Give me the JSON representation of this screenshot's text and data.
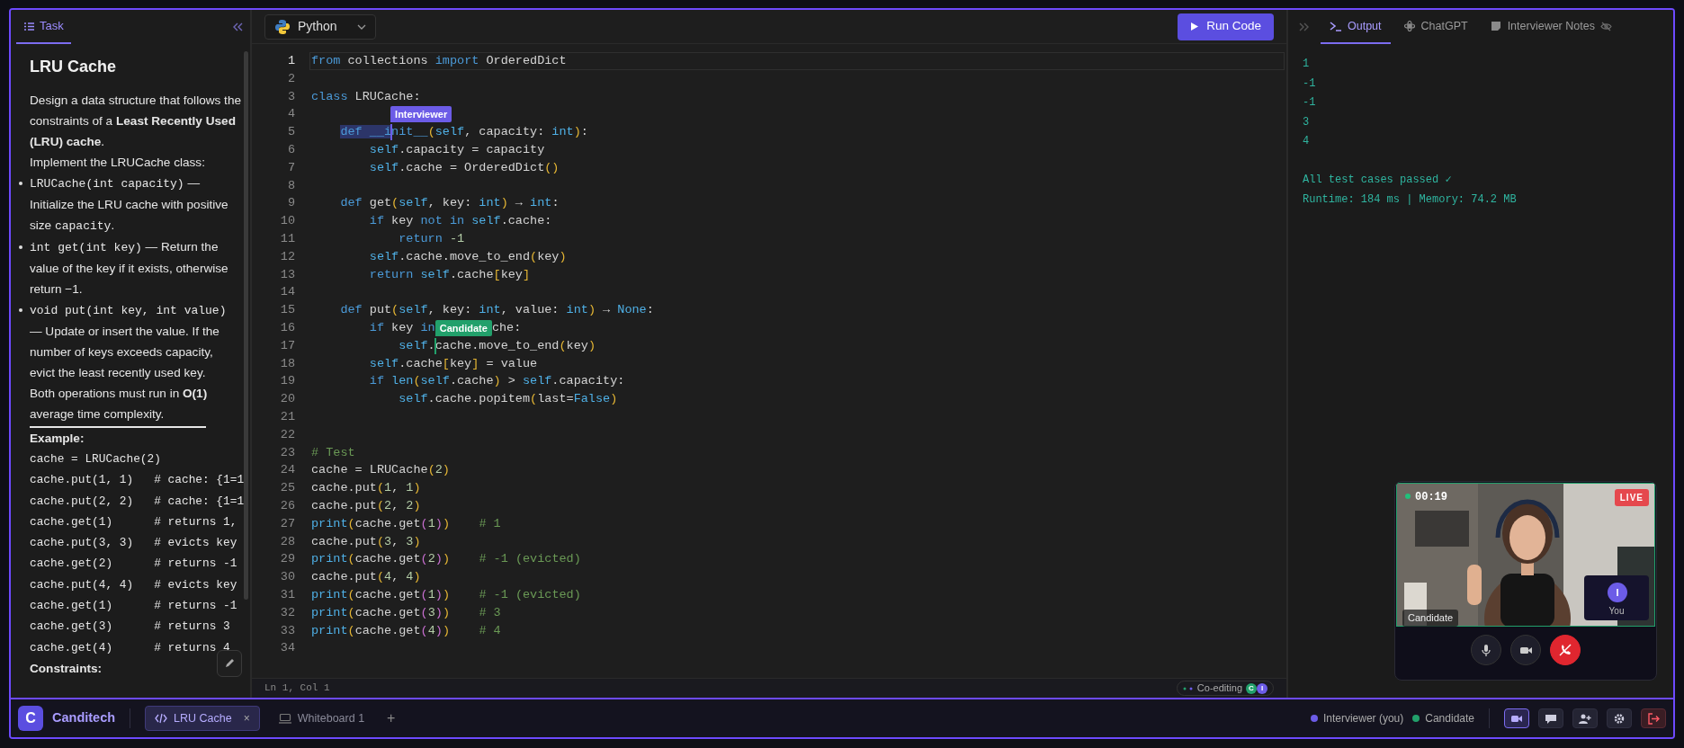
{
  "task_panel": {
    "tabs": [
      {
        "label": "Task",
        "selected": true
      }
    ],
    "title": "LRU Cache",
    "paragraphs": [
      "Design a data structure that follows the constraints of a **Least Recently Used (LRU) cache**.",
      "Implement the LRUCache class:"
    ],
    "bullets": [
      [
        {
          "kind": "code",
          "text": "LRUCache(int capacity)"
        },
        {
          "kind": "text",
          "text": " — Initialize the LRU cache with positive size "
        },
        {
          "kind": "code",
          "text": "capacity"
        },
        {
          "kind": "text",
          "text": "."
        }
      ],
      [
        {
          "kind": "code",
          "text": "int get(int key)"
        },
        {
          "kind": "text",
          "text": " — Return the value of the key if it exists, otherwise return −1."
        }
      ],
      [
        {
          "kind": "code",
          "text": "void put(int key, int value)"
        },
        {
          "kind": "text",
          "text": " — Update or insert the value. If the number of keys exceeds capacity, evict the least recently used key."
        }
      ]
    ],
    "note": "Both operations must run in **O(1)** average time complexity.",
    "example_heading": "Example:",
    "example_lines": [
      "cache = LRUCache(2)",
      "cache.put(1, 1)   # cache: {1=1",
      "cache.put(2, 2)   # cache: {1=1",
      "cache.get(1)      # returns 1,",
      "cache.put(3, 3)   # evicts key",
      "cache.get(2)      # returns -1",
      "cache.put(4, 4)   # evicts key",
      "cache.get(1)      # returns -1",
      "cache.get(3)      # returns 3",
      "cache.get(4)      # returns 4"
    ],
    "constraints_heading": "Constraints:"
  },
  "editor": {
    "language": "Python",
    "run_button": "Run Code",
    "status": "Ln 1, Col 1",
    "coediting": {
      "label": "Co-editing",
      "avatars": [
        {
          "initial": "C",
          "color": "#22a06b"
        },
        {
          "initial": "I",
          "color": "#6c5ce7"
        }
      ]
    },
    "lines": [
      {
        "number": "1",
        "current": true,
        "segments": [
          {
            "kind": "keyword",
            "text": "from"
          },
          {
            "kind": "plain",
            "text": " collections "
          },
          {
            "kind": "keyword",
            "text": "import"
          },
          {
            "kind": "plain",
            "text": " OrderedDict"
          }
        ]
      },
      {
        "number": "2",
        "current": false
      },
      {
        "number": "3",
        "current": false,
        "segments": [
          {
            "kind": "keyword",
            "text": "class"
          },
          {
            "kind": "plain",
            "text": " LRUCache:"
          }
        ],
        "children": [
          {
            "number": "4",
            "current": false,
            "segments": [
              {
                "kind": "cursor-label",
                "label": "Interviewer",
                "color": "#6c5ce7"
              }
            ]
          },
          {
            "number": "5",
            "current": false,
            "segments": [
              {
                "kind": "selection",
                "text": "def __i"
              },
              {
                "kind": "caret",
                "color": "#6c5ce7"
              },
              {
                "kind": "keyword",
                "text": "nit__"
              },
              {
                "kind": "paren",
                "text": "("
              },
              {
                "kind": "builtin",
                "text": "self"
              },
              {
                "kind": "plain",
                "text": ", capacity: "
              },
              {
                "kind": "builtin",
                "text": "int"
              },
              {
                "kind": "paren",
                "text": ")"
              },
              {
                "kind": "plain",
                "text": ":"
              }
            ],
            "children": [
              {
                "number": "6",
                "current": false,
                "segments": [
                  {
                    "kind": "builtin",
                    "text": "self"
                  },
                  {
                    "kind": "plain",
                    "text": ".capacity = capacity"
                  }
                ]
              },
              {
                "number": "7",
                "current": false,
                "segments": [
                  {
                    "kind": "builtin",
                    "text": "self"
                  },
                  {
                    "kind": "plain",
                    "text": ".cache = OrderedDict"
                  },
                  {
                    "kind": "paren",
                    "text": "()"
                  }
                ]
              }
            ]
          },
          {
            "number": "8",
            "current": false
          },
          {
            "number": "9",
            "current": false,
            "segments": [
              {
                "kind": "keyword",
                "text": "def"
              },
              {
                "kind": "plain",
                "text": " get"
              },
              {
                "kind": "paren",
                "text": "("
              },
              {
                "kind": "builtin",
                "text": "self"
              },
              {
                "kind": "plain",
                "text": ", key: "
              },
              {
                "kind": "builtin",
                "text": "int"
              },
              {
                "kind": "paren",
                "text": ")"
              },
              {
                "kind": "plain",
                "text": " → "
              },
              {
                "kind": "builtin",
                "text": "int"
              },
              {
                "kind": "plain",
                "text": ":"
              }
            ],
            "children": [
              {
                "number": "10",
                "current": false,
                "segments": [
                  {
                    "kind": "keyword",
                    "text": "if"
                  },
                  {
                    "kind": "plain",
                    "text": " key "
                  },
                  {
                    "kind": "keyword",
                    "text": "not in"
                  },
                  {
                    "kind": "builtin",
                    "text": " self"
                  },
                  {
                    "kind": "plain",
                    "text": ".cache:"
                  }
                ],
                "children": [
                  {
                    "number": "11",
                    "current": false,
                    "segments": [
                      {
                        "kind": "keyword",
                        "text": "return"
                      },
                      {
                        "kind": "number",
                        "text": " -1"
                      }
                    ]
                  }
                ]
              },
              {
                "number": "12",
                "current": false,
                "segments": [
                  {
                    "kind": "builtin",
                    "text": "self"
                  },
                  {
                    "kind": "plain",
                    "text": ".cache.move_to_end"
                  },
                  {
                    "kind": "paren",
                    "text": "("
                  },
                  {
                    "kind": "plain",
                    "text": "key"
                  },
                  {
                    "kind": "paren",
                    "text": ")"
                  }
                ]
              },
              {
                "number": "13",
                "current": false,
                "segments": [
                  {
                    "kind": "keyword",
                    "text": "return"
                  },
                  {
                    "kind": "builtin",
                    "text": " self"
                  },
                  {
                    "kind": "plain",
                    "text": ".cache"
                  },
                  {
                    "kind": "paren",
                    "text": "["
                  },
                  {
                    "kind": "plain",
                    "text": "key"
                  },
                  {
                    "kind": "paren",
                    "text": "]"
                  }
                ]
              }
            ]
          },
          {
            "number": "14",
            "current": false
          },
          {
            "number": "15",
            "current": false,
            "segments": [
              {
                "kind": "keyword",
                "text": "def"
              },
              {
                "kind": "plain",
                "text": " put"
              },
              {
                "kind": "paren",
                "text": "("
              },
              {
                "kind": "builtin",
                "text": "self"
              },
              {
                "kind": "plain",
                "text": ", key: "
              },
              {
                "kind": "builtin",
                "text": "int"
              },
              {
                "kind": "plain",
                "text": ", value: "
              },
              {
                "kind": "builtin",
                "text": "int"
              },
              {
                "kind": "paren",
                "text": ")"
              },
              {
                "kind": "plain",
                "text": " → "
              },
              {
                "kind": "builtin",
                "text": "None"
              },
              {
                "kind": "plain",
                "text": ":"
              }
            ],
            "children": [
              {
                "number": "16",
                "current": false,
                "segments": [
                  {
                    "kind": "keyword",
                    "text": "if"
                  },
                  {
                    "kind": "plain",
                    "text": " key "
                  },
                  {
                    "kind": "keyword",
                    "text": "in"
                  },
                  {
                    "kind": "cursor-label",
                    "label": "Candidate",
                    "color": "#22a06b"
                  },
                  {
                    "kind": "plain",
                    "text": "che:"
                  }
                ],
                "children": [
                  {
                    "number": "17",
                    "current": false,
                    "segments": [
                      {
                        "kind": "builtin",
                        "text": "self"
                      },
                      {
                        "kind": "plain",
                        "text": "."
                      },
                      {
                        "kind": "caret",
                        "color": "#22a06b"
                      },
                      {
                        "kind": "plain",
                        "text": "cache.move_to_end"
                      },
                      {
                        "kind": "paren",
                        "text": "("
                      },
                      {
                        "kind": "plain",
                        "text": "key"
                      },
                      {
                        "kind": "paren",
                        "text": ")"
                      }
                    ]
                  }
                ]
              },
              {
                "number": "18",
                "current": false,
                "segments": [
                  {
                    "kind": "builtin",
                    "text": "self"
                  },
                  {
                    "kind": "plain",
                    "text": ".cache"
                  },
                  {
                    "kind": "paren",
                    "text": "["
                  },
                  {
                    "kind": "plain",
                    "text": "key"
                  },
                  {
                    "kind": "paren",
                    "text": "]"
                  },
                  {
                    "kind": "plain",
                    "text": " = value"
                  }
                ]
              },
              {
                "number": "19",
                "current": false,
                "segments": [
                  {
                    "kind": "keyword",
                    "text": "if"
                  },
                  {
                    "kind": "builtin",
                    "text": " len"
                  },
                  {
                    "kind": "paren",
                    "text": "("
                  },
                  {
                    "kind": "builtin",
                    "text": "self"
                  },
                  {
                    "kind": "plain",
                    "text": ".cache"
                  },
                  {
                    "kind": "paren",
                    "text": ")"
                  },
                  {
                    "kind": "plain",
                    "text": " > "
                  },
                  {
                    "kind": "builtin",
                    "text": "self"
                  },
                  {
                    "kind": "plain",
                    "text": ".capacity:"
                  }
                ],
                "children": [
                  {
                    "number": "20",
                    "current": false,
                    "segments": [
                      {
                        "kind": "builtin",
                        "text": "self"
                      },
                      {
                        "kind": "plain",
                        "text": ".cache.popitem"
                      },
                      {
                        "kind": "paren",
                        "text": "("
                      },
                      {
                        "kind": "plain",
                        "text": "last="
                      },
                      {
                        "kind": "builtin",
                        "text": "False"
                      },
                      {
                        "kind": "paren",
                        "text": ")"
                      }
                    ]
                  }
                ]
              }
            ]
          }
        ]
      },
      {
        "number": "21",
        "current": false
      },
      {
        "number": "22",
        "current": false
      },
      {
        "number": "23",
        "current": false,
        "segments": [
          {
            "kind": "comment",
            "text": "# Test"
          }
        ]
      },
      {
        "number": "24",
        "current": false,
        "segments": [
          {
            "kind": "plain",
            "text": "cache = LRUCache"
          },
          {
            "kind": "paren",
            "text": "("
          },
          {
            "kind": "number",
            "text": "2"
          },
          {
            "kind": "paren",
            "text": ")"
          }
        ]
      },
      {
        "number": "25",
        "current": false,
        "segments": [
          {
            "kind": "plain",
            "text": "cache.put"
          },
          {
            "kind": "paren",
            "text": "("
          },
          {
            "kind": "number",
            "text": "1"
          },
          {
            "kind": "plain",
            "text": ", "
          },
          {
            "kind": "number",
            "text": "1"
          },
          {
            "kind": "paren",
            "text": ")"
          }
        ]
      },
      {
        "number": "26",
        "current": false,
        "segments": [
          {
            "kind": "plain",
            "text": "cache.put"
          },
          {
            "kind": "paren",
            "text": "("
          },
          {
            "kind": "number",
            "text": "2"
          },
          {
            "kind": "plain",
            "text": ", "
          },
          {
            "kind": "number",
            "text": "2"
          },
          {
            "kind": "paren",
            "text": ")"
          }
        ]
      },
      {
        "number": "27",
        "current": false,
        "segments": [
          {
            "kind": "builtin",
            "text": "print"
          },
          {
            "kind": "paren",
            "text": "("
          },
          {
            "kind": "plain",
            "text": "cache.get"
          },
          {
            "kind": "paren2",
            "text": "("
          },
          {
            "kind": "number",
            "text": "1"
          },
          {
            "kind": "paren2",
            "text": ")"
          },
          {
            "kind": "paren",
            "text": ")"
          },
          {
            "kind": "comment",
            "text": "    # 1"
          }
        ]
      },
      {
        "number": "28",
        "current": false,
        "segments": [
          {
            "kind": "plain",
            "text": "cache.put"
          },
          {
            "kind": "paren",
            "text": "("
          },
          {
            "kind": "number",
            "text": "3"
          },
          {
            "kind": "plain",
            "text": ", "
          },
          {
            "kind": "number",
            "text": "3"
          },
          {
            "kind": "paren",
            "text": ")"
          }
        ]
      },
      {
        "number": "29",
        "current": false,
        "segments": [
          {
            "kind": "builtin",
            "text": "print"
          },
          {
            "kind": "paren",
            "text": "("
          },
          {
            "kind": "plain",
            "text": "cache.get"
          },
          {
            "kind": "paren2",
            "text": "("
          },
          {
            "kind": "number",
            "text": "2"
          },
          {
            "kind": "paren2",
            "text": ")"
          },
          {
            "kind": "paren",
            "text": ")"
          },
          {
            "kind": "comment",
            "text": "    # -1 (evicted)"
          }
        ]
      },
      {
        "number": "30",
        "current": false,
        "segments": [
          {
            "kind": "plain",
            "text": "cache.put"
          },
          {
            "kind": "paren",
            "text": "("
          },
          {
            "kind": "number",
            "text": "4"
          },
          {
            "kind": "plain",
            "text": ", "
          },
          {
            "kind": "number",
            "text": "4"
          },
          {
            "kind": "paren",
            "text": ")"
          }
        ]
      },
      {
        "number": "31",
        "current": false,
        "segments": [
          {
            "kind": "builtin",
            "text": "print"
          },
          {
            "kind": "paren",
            "text": "("
          },
          {
            "kind": "plain",
            "text": "cache.get"
          },
          {
            "kind": "paren2",
            "text": "("
          },
          {
            "kind": "number",
            "text": "1"
          },
          {
            "kind": "paren2",
            "text": ")"
          },
          {
            "kind": "paren",
            "text": ")"
          },
          {
            "kind": "comment",
            "text": "    # -1 (evicted)"
          }
        ]
      },
      {
        "number": "32",
        "current": false,
        "segments": [
          {
            "kind": "builtin",
            "text": "print"
          },
          {
            "kind": "paren",
            "text": "("
          },
          {
            "kind": "plain",
            "text": "cache.get"
          },
          {
            "kind": "paren2",
            "text": "("
          },
          {
            "kind": "number",
            "text": "3"
          },
          {
            "kind": "paren2",
            "text": ")"
          },
          {
            "kind": "paren",
            "text": ")"
          },
          {
            "kind": "comment",
            "text": "    # 3"
          }
        ]
      },
      {
        "number": "33",
        "current": false,
        "segments": [
          {
            "kind": "builtin",
            "text": "print"
          },
          {
            "kind": "paren",
            "text": "("
          },
          {
            "kind": "plain",
            "text": "cache.get"
          },
          {
            "kind": "paren2",
            "text": "("
          },
          {
            "kind": "number",
            "text": "4"
          },
          {
            "kind": "paren2",
            "text": ")"
          },
          {
            "kind": "paren",
            "text": ")"
          },
          {
            "kind": "comment",
            "text": "    # 4"
          }
        ]
      },
      {
        "number": "34",
        "current": false
      }
    ]
  },
  "side_panel": {
    "tabs": [
      {
        "label": "Output",
        "kind": "terminal",
        "selected": true,
        "private": false
      },
      {
        "label": "ChatGPT",
        "kind": "chatgpt",
        "selected": false,
        "private": false
      },
      {
        "label": "Interviewer Notes",
        "kind": "notes",
        "selected": false,
        "private": true
      }
    ],
    "output_lines": [
      "1",
      "-1",
      "-1",
      "3",
      "4"
    ],
    "summary": [
      "All test cases passed ✓",
      "Runtime: 184 ms | Memory: 74.2 MB"
    ]
  },
  "video": {
    "timer": "00:19",
    "live": "LIVE",
    "name": "Candidate",
    "self_view": {
      "initial": "I",
      "label": "You"
    },
    "controls": [
      {
        "kind": "mic"
      },
      {
        "kind": "camera"
      },
      {
        "kind": "hangup"
      }
    ]
  },
  "bottom_bar": {
    "logo": "C",
    "brand": "Canditech",
    "tabs": [
      {
        "label": "LRU Cache",
        "kind": "code",
        "selected": true,
        "close": "×"
      },
      {
        "label": "Whiteboard 1",
        "kind": "whiteboard",
        "selected": false
      }
    ],
    "add": "+",
    "participants": [
      {
        "label": "Interviewer (you)",
        "color": "#6c5ce7"
      },
      {
        "label": "Candidate",
        "color": "#22a06b"
      }
    ],
    "tools": [
      {
        "kind": "video",
        "active": true
      },
      {
        "kind": "chat",
        "active": false
      },
      {
        "kind": "invite",
        "active": false
      },
      {
        "kind": "settings",
        "active": false
      },
      {
        "kind": "leave",
        "active": false
      }
    ]
  }
}
